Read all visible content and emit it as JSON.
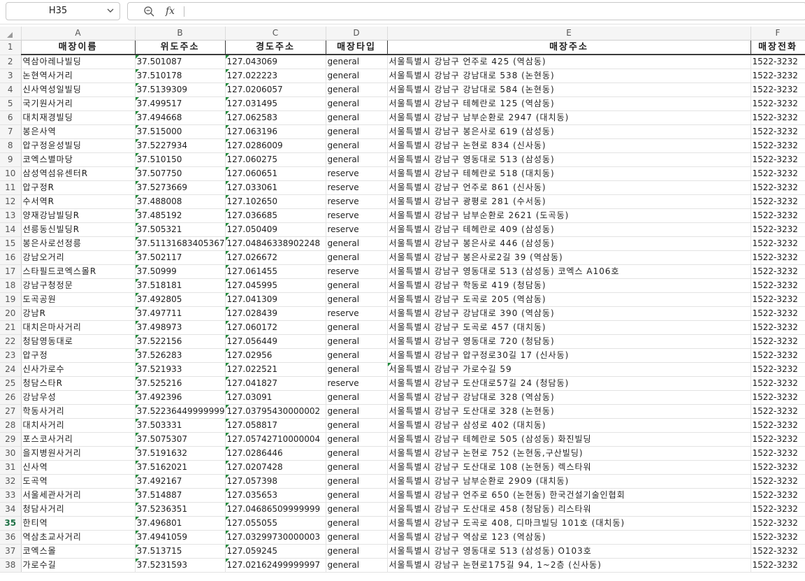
{
  "name_box": "H35",
  "formula_content": "",
  "columns": [
    "A",
    "B",
    "C",
    "D",
    "E",
    "F"
  ],
  "header": [
    "매장이름",
    "위도주소",
    "경도주소",
    "매장타입",
    "매장주소",
    "매장전화"
  ],
  "active_row": "35",
  "rows": [
    {
      "num": "2",
      "cells": [
        "역삼아레나빌딩",
        "37.501087",
        "127.043069",
        "general",
        "서울특별시 강남구 언주로 425 (역삼동)",
        "1522-3232"
      ]
    },
    {
      "num": "3",
      "cells": [
        "논현역사거리",
        "37.510178",
        "127.022223",
        "general",
        "서울특별시 강남구 강남대로 538 (논현동)",
        "1522-3232"
      ]
    },
    {
      "num": "4",
      "cells": [
        "신사역성일빌딩",
        "37.5139309",
        "127.0206057",
        "general",
        "서울특별시 강남구 강남대로 584 (논현동)",
        "1522-3232"
      ]
    },
    {
      "num": "5",
      "cells": [
        "국기원사거리",
        "37.499517",
        "127.031495",
        "general",
        "서울특별시 강남구 테헤란로 125 (역삼동)",
        "1522-3232"
      ]
    },
    {
      "num": "6",
      "cells": [
        "대치재경빌딩",
        "37.494668",
        "127.062583",
        "general",
        "서울특별시 강남구 남부순환로 2947 (대치동)",
        "1522-3232"
      ]
    },
    {
      "num": "7",
      "cells": [
        "봉은사역",
        "37.515000",
        "127.063196",
        "general",
        "서울특별시 강남구 봉은사로 619 (삼성동)",
        "1522-3232"
      ]
    },
    {
      "num": "8",
      "cells": [
        "압구정윤성빌딩",
        "37.5227934",
        "127.0286009",
        "general",
        "서울특별시 강남구 논현로 834 (신사동)",
        "1522-3232"
      ]
    },
    {
      "num": "9",
      "cells": [
        "코엑스별마당",
        "37.510150",
        "127.060275",
        "general",
        "서울특별시 강남구 영동대로 513 (삼성동)",
        "1522-3232"
      ]
    },
    {
      "num": "10",
      "cells": [
        "삼성역섬유센터R",
        "37.507750",
        "127.060651",
        "reserve",
        "서울특별시 강남구 테헤란로 518 (대치동)",
        "1522-3232"
      ]
    },
    {
      "num": "11",
      "cells": [
        "압구정R",
        "37.5273669",
        "127.033061",
        "reserve",
        "서울특별시 강남구 언주로 861 (신사동)",
        "1522-3232"
      ]
    },
    {
      "num": "12",
      "cells": [
        "수서역R",
        "37.488008",
        "127.102650",
        "reserve",
        "서울특별시 강남구 광평로 281 (수서동)",
        "1522-3232"
      ]
    },
    {
      "num": "13",
      "cells": [
        "양재강남빌딩R",
        "37.485192",
        "127.036685",
        "reserve",
        "서울특별시 강남구 남부순환로 2621 (도곡동)",
        "1522-3232"
      ]
    },
    {
      "num": "14",
      "cells": [
        "선릉동신빌딩R",
        "37.505321",
        "127.050409",
        "reserve",
        "서울특별시 강남구 테헤란로 409 (삼성동)",
        "1522-3232"
      ]
    },
    {
      "num": "15",
      "cells": [
        "봉은사로선정릉",
        "37.51131683405367",
        "127.04846338902248",
        "general",
        "서울특별시 강남구 봉은사로 446 (삼성동)",
        "1522-3232"
      ]
    },
    {
      "num": "16",
      "cells": [
        "강남오거리",
        "37.502117",
        "127.026672",
        "general",
        "서울특별시 강남구 봉은사로2길 39 (역삼동)",
        "1522-3232"
      ]
    },
    {
      "num": "17",
      "cells": [
        "스타필드코엑스몰R",
        "37.50999",
        "127.061455",
        "reserve",
        "서울특별시 강남구 영동대로 513 (삼성동) 코엑스 A106호",
        "1522-3232"
      ]
    },
    {
      "num": "18",
      "cells": [
        "강남구청정문",
        "37.518181",
        "127.045995",
        "general",
        "서울특별시 강남구 학동로 419 (청담동)",
        "1522-3232"
      ]
    },
    {
      "num": "19",
      "cells": [
        "도곡공원",
        "37.492805",
        "127.041309",
        "general",
        "서울특별시 강남구 도곡로 205 (역삼동)",
        "1522-3232"
      ]
    },
    {
      "num": "20",
      "cells": [
        "강남R",
        "37.497711",
        "127.028439",
        "reserve",
        "서울특별시 강남구 강남대로 390 (역삼동)",
        "1522-3232"
      ]
    },
    {
      "num": "21",
      "cells": [
        "대치은마사거리",
        "37.498973",
        "127.060172",
        "general",
        "서울특별시 강남구 도곡로 457 (대치동)",
        "1522-3232"
      ]
    },
    {
      "num": "22",
      "cells": [
        "청담영동대로",
        "37.522156",
        "127.056449",
        "general",
        "서울특별시 강남구 영동대로 720 (청담동)",
        "1522-3232"
      ]
    },
    {
      "num": "23",
      "cells": [
        "압구정",
        "37.526283",
        "127.02956",
        "general",
        "서울특별시 강남구 압구정로30길 17 (신사동)",
        "1522-3232"
      ]
    },
    {
      "num": "24",
      "cells": [
        "신사가로수",
        "37.521933",
        "127.022521",
        "general",
        "서울특별시 강남구 가로수길 59",
        "1522-3232"
      ]
    },
    {
      "num": "25",
      "cells": [
        "청담스타R",
        "37.525216",
        "127.041827",
        "reserve",
        "서울특별시 강남구 도산대로57길 24 (청담동)",
        "1522-3232"
      ]
    },
    {
      "num": "26",
      "cells": [
        "강남우성",
        "37.492396",
        "127.03091",
        "general",
        "서울특별시 강남구 강남대로 328 (역삼동)",
        "1522-3232"
      ]
    },
    {
      "num": "27",
      "cells": [
        "학동사거리",
        "37.52236449999999",
        "127.03795430000002",
        "general",
        "서울특별시 강남구 도산대로 328 (논현동)",
        "1522-3232"
      ]
    },
    {
      "num": "28",
      "cells": [
        "대치사거리",
        "37.503331",
        "127.058817",
        "general",
        "서울특별시 강남구 삼성로 402 (대치동)",
        "1522-3232"
      ]
    },
    {
      "num": "29",
      "cells": [
        "포스코사거리",
        "37.5075307",
        "127.05742710000004",
        "general",
        "서울특별시 강남구 테헤란로 505 (삼성동) 화진빌딩",
        "1522-3232"
      ]
    },
    {
      "num": "30",
      "cells": [
        "을지병원사거리",
        "37.5191632",
        "127.0286446",
        "general",
        "서울특별시 강남구 논현로 752 (논현동,구산빌딩)",
        "1522-3232"
      ]
    },
    {
      "num": "31",
      "cells": [
        "신사역",
        "37.5162021",
        "127.0207428",
        "general",
        "서울특별시 강남구 도산대로 108 (논현동) 렉스타워",
        "1522-3232"
      ]
    },
    {
      "num": "32",
      "cells": [
        "도곡역",
        "37.492167",
        "127.057398",
        "general",
        "서울특별시 강남구 남부순환로 2909 (대치동)",
        "1522-3232"
      ]
    },
    {
      "num": "33",
      "cells": [
        "서울세관사거리",
        "37.514887",
        "127.035653",
        "general",
        "서울특별시 강남구 언주로 650 (논현동) 한국건설기술인협회",
        "1522-3232"
      ]
    },
    {
      "num": "34",
      "cells": [
        "청담사거리",
        "37.5236351",
        "127.04686509999999",
        "general",
        "서울특별시 강남구 도산대로 458 (청담동) 리스타워",
        "1522-3232"
      ]
    },
    {
      "num": "35",
      "cells": [
        "한티역",
        "37.496801",
        "127.055055",
        "general",
        "서울특별시 강남구 도곡로 408, 디마크빌딩 101호 (대치동)",
        "1522-3232"
      ]
    },
    {
      "num": "36",
      "cells": [
        "역삼초교사거리",
        "37.4941059",
        "127.03299730000003",
        "general",
        "서울특별시 강남구 역삼로 123 (역삼동)",
        "1522-3232"
      ]
    },
    {
      "num": "37",
      "cells": [
        "코엑스몰",
        "37.513715",
        "127.059245",
        "general",
        "서울특별시 강남구 영동대로 513 (삼성동) O103호",
        "1522-3232"
      ]
    },
    {
      "num": "38",
      "cells": [
        "가로수길",
        "37.5231593",
        "127.02162499999997",
        "general",
        "서울특별시 강남구 논현로175길 94, 1~2층 (신사동)",
        "1522-3232"
      ]
    }
  ]
}
